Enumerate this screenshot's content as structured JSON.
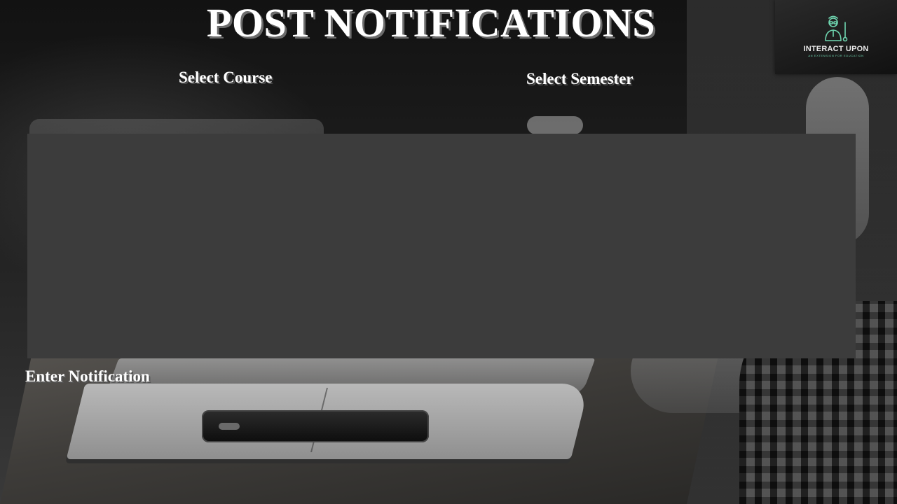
{
  "page": {
    "title": "POST NOTIFICATIONS"
  },
  "form": {
    "course_label": "Select Course",
    "semester_label": "Select Semester",
    "notification_label": "Enter Notification",
    "notification_value": ""
  },
  "logo": {
    "name": "INTERACT UPON",
    "tagline": "AN EXTENSION FOR EDUCATION",
    "icon": "teacher-icon",
    "accent_color": "#6fd6b0"
  },
  "colors": {
    "panel": "#3c3c3c",
    "heading_text": "#ffffff"
  }
}
